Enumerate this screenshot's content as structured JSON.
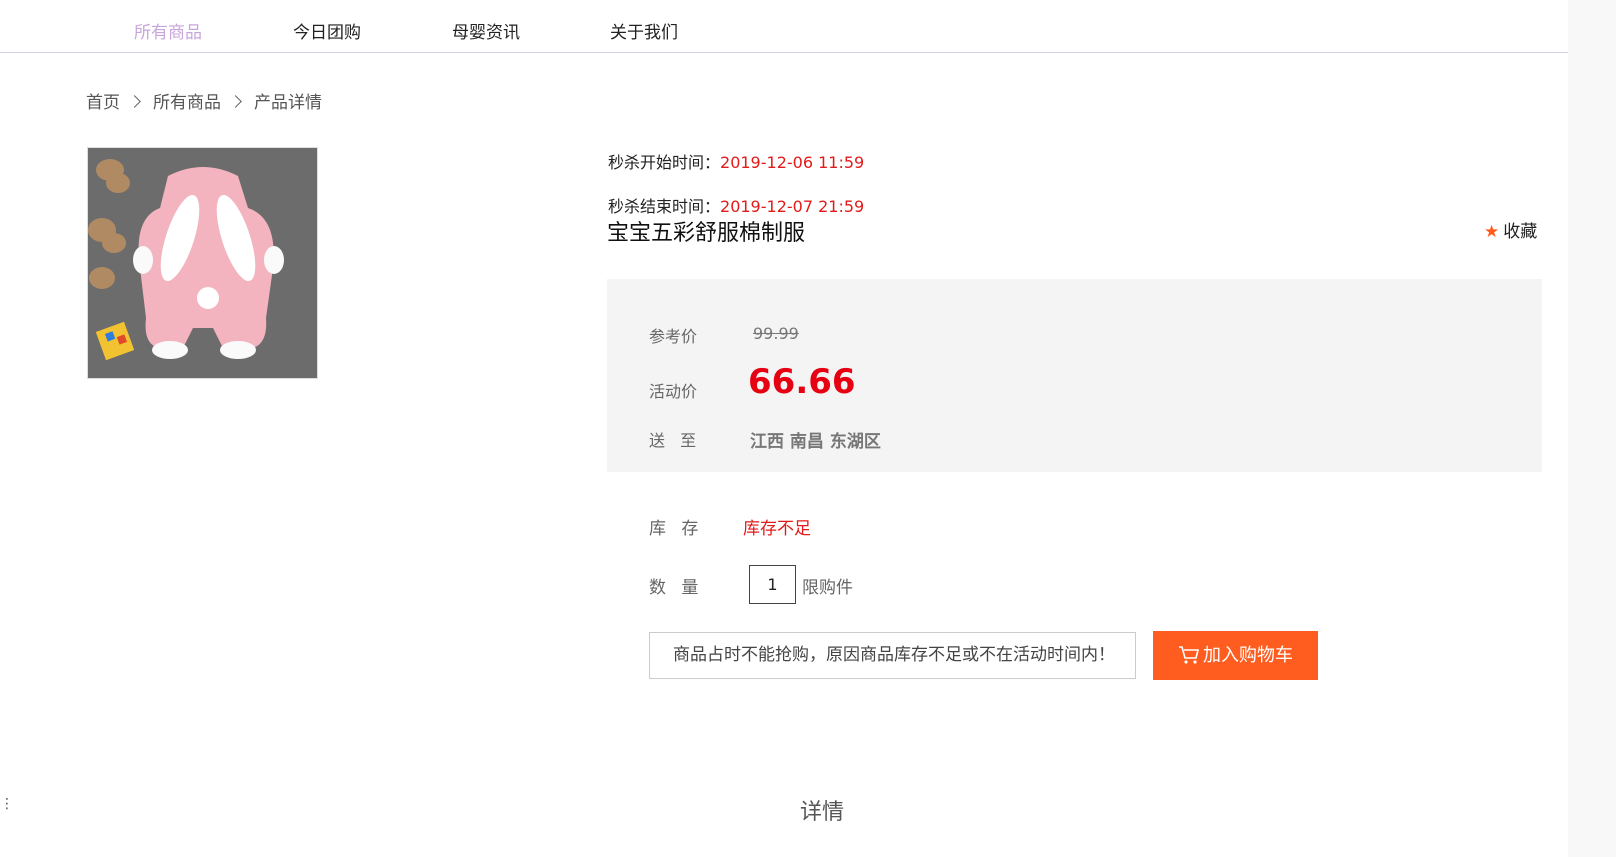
{
  "nav": {
    "items": [
      "所有商品",
      "今日团购",
      "母婴资讯",
      "关于我们"
    ],
    "active_index": 0
  },
  "breadcrumb": [
    "首页",
    "所有商品",
    "产品详情"
  ],
  "product": {
    "seckill_start_label": "秒杀开始时间：",
    "seckill_start_value": "2019-12-06 11:59",
    "seckill_end_label": "秒杀结束时间：",
    "seckill_end_value": "2019-12-07 21:59",
    "title": "宝宝五彩舒服棉制服",
    "favorite_label": "收藏"
  },
  "pricing": {
    "reference_label": "参考价",
    "reference_price": "99.99",
    "activity_label": "活动价",
    "activity_price": "66.66",
    "ship_label": "送 至",
    "ship_to": "江西  南昌  东湖区"
  },
  "stock": {
    "label": "库 存",
    "value": "库存不足"
  },
  "quantity": {
    "label": "数 量",
    "value": "1",
    "limit_text": "限购件"
  },
  "notice": "商品占时不能抢购，原因商品库存不足或不在活动时间内！",
  "cart_button": "加入购物车",
  "detail_heading": "详情",
  "colors": {
    "accent": "#ff5c1f",
    "price_red": "#e60012",
    "nav_active": "#c8a6dc"
  }
}
